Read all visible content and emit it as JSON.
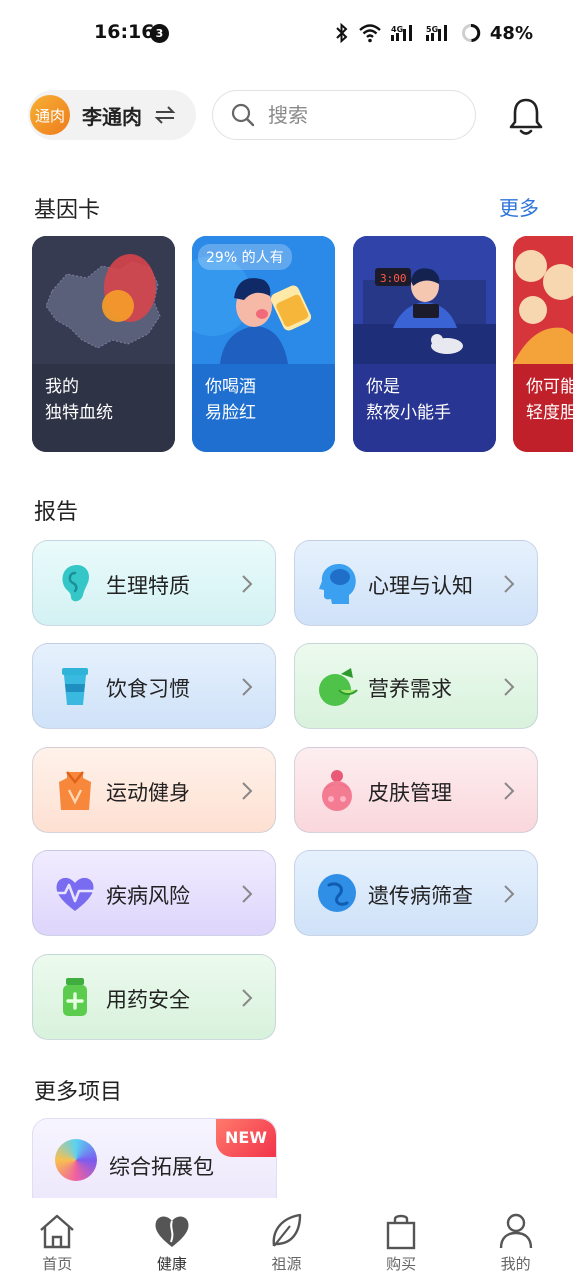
{
  "status_bar": {
    "time": "16:16",
    "notification_count": "3",
    "battery": "48%"
  },
  "header": {
    "avatar_text": "通肉",
    "account_name": "李通肉",
    "search_placeholder": "搜索"
  },
  "gene_section": {
    "title": "基因卡",
    "more": "更多",
    "cards": [
      {
        "line1": "我的",
        "line2": "独特血统"
      },
      {
        "line1": "你喝酒",
        "line2": "易脸红",
        "tag": "29% 的人有"
      },
      {
        "line1": "你是",
        "line2": "熬夜小能手",
        "clock": "3:00"
      },
      {
        "line1": "你可能",
        "line2": "轻度胆"
      }
    ]
  },
  "report_section": {
    "title": "报告",
    "items": [
      {
        "label": "生理特质",
        "icon": "ear-icon"
      },
      {
        "label": "心理与认知",
        "icon": "head-brain-icon"
      },
      {
        "label": "饮食习惯",
        "icon": "cup-icon"
      },
      {
        "label": "营养需求",
        "icon": "lime-icon"
      },
      {
        "label": "运动健身",
        "icon": "sport-shirt-icon"
      },
      {
        "label": "皮肤管理",
        "icon": "face-icon"
      },
      {
        "label": "疾病风险",
        "icon": "heart-pulse-icon"
      },
      {
        "label": "遗传病筛查",
        "icon": "cell-icon"
      },
      {
        "label": "用药安全",
        "icon": "medicine-bottle-icon"
      }
    ]
  },
  "more_section": {
    "title": "更多项目",
    "bundle_label": "综合拓展包",
    "new_tag": "NEW"
  },
  "bottom_nav": {
    "items": [
      {
        "label": "首页",
        "icon": "home-icon"
      },
      {
        "label": "健康",
        "icon": "heart-icon",
        "active": true
      },
      {
        "label": "祖源",
        "icon": "leaf-icon"
      },
      {
        "label": "购买",
        "icon": "bag-icon"
      },
      {
        "label": "我的",
        "icon": "person-icon"
      }
    ]
  },
  "colors": {
    "accent_blue": "#2f74d8",
    "avatar_orange": "#f39a2a"
  }
}
